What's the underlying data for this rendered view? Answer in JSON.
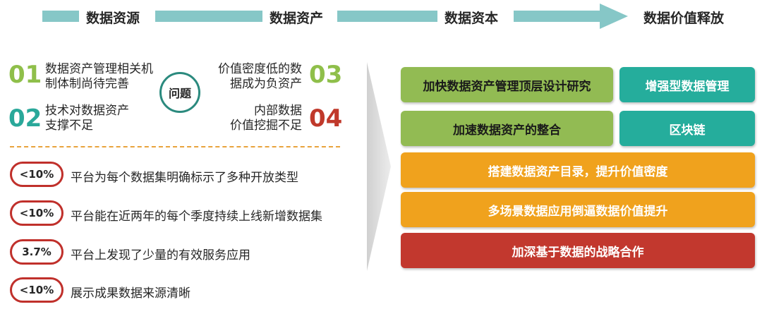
{
  "flow": {
    "stages": [
      "数据资源",
      "数据资产",
      "数据资本",
      "数据价值释放"
    ],
    "color": "#86c7c7"
  },
  "problems": {
    "center_label": "问题",
    "items": [
      {
        "num": "01",
        "lines": [
          "数据资产管理相关机",
          "制体制尚待完善"
        ],
        "color": "#8fbf4a"
      },
      {
        "num": "02",
        "lines": [
          "技术对数据资产",
          "支撑不足"
        ],
        "color": "#2aa89a"
      },
      {
        "num": "03",
        "lines": [
          "价值密度低的数",
          "据成为负资产"
        ],
        "color": "#8fbf4a"
      },
      {
        "num": "04",
        "lines": [
          "内部数据",
          "价值挖掘不足"
        ],
        "color": "#c0392b"
      }
    ]
  },
  "stats": [
    {
      "value": "<10%",
      "text": "平台为每个数据集明确标示了多种开放类型"
    },
    {
      "value": "<10%",
      "text": "平台能在近两年的每个季度持续上线新增数据集"
    },
    {
      "value": "3.7%",
      "text": "平台上发现了少量的有效服务应用"
    },
    {
      "value": "<10%",
      "text": "展示成果数据来源清晰"
    }
  ],
  "solutions": [
    {
      "label": "加快数据资产管理顶层设计研究",
      "color": "#92bb53"
    },
    {
      "label": "增强型数据管理",
      "color": "#25ad9c"
    },
    {
      "label": "加速数据资产的整合",
      "color": "#92bb53"
    },
    {
      "label": "区块链",
      "color": "#25ad9c"
    },
    {
      "label": "搭建数据资产目录，提升价值密度",
      "color": "#f0a21d"
    },
    {
      "label": "多场景数据应用倒逼数据价值提升",
      "color": "#f0a21d"
    },
    {
      "label": "加深基于数据的战略合作",
      "color": "#c2382e"
    }
  ]
}
